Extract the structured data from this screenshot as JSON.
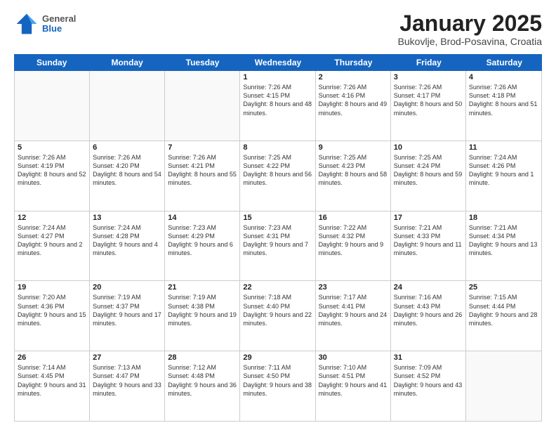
{
  "logo": {
    "general": "General",
    "blue": "Blue"
  },
  "title": "January 2025",
  "subtitle": "Bukovlje, Brod-Posavina, Croatia",
  "days": [
    "Sunday",
    "Monday",
    "Tuesday",
    "Wednesday",
    "Thursday",
    "Friday",
    "Saturday"
  ],
  "weeks": [
    [
      {
        "day": "",
        "info": ""
      },
      {
        "day": "",
        "info": ""
      },
      {
        "day": "",
        "info": ""
      },
      {
        "day": "1",
        "info": "Sunrise: 7:26 AM\nSunset: 4:15 PM\nDaylight: 8 hours\nand 48 minutes."
      },
      {
        "day": "2",
        "info": "Sunrise: 7:26 AM\nSunset: 4:16 PM\nDaylight: 8 hours\nand 49 minutes."
      },
      {
        "day": "3",
        "info": "Sunrise: 7:26 AM\nSunset: 4:17 PM\nDaylight: 8 hours\nand 50 minutes."
      },
      {
        "day": "4",
        "info": "Sunrise: 7:26 AM\nSunset: 4:18 PM\nDaylight: 8 hours\nand 51 minutes."
      }
    ],
    [
      {
        "day": "5",
        "info": "Sunrise: 7:26 AM\nSunset: 4:19 PM\nDaylight: 8 hours\nand 52 minutes."
      },
      {
        "day": "6",
        "info": "Sunrise: 7:26 AM\nSunset: 4:20 PM\nDaylight: 8 hours\nand 54 minutes."
      },
      {
        "day": "7",
        "info": "Sunrise: 7:26 AM\nSunset: 4:21 PM\nDaylight: 8 hours\nand 55 minutes."
      },
      {
        "day": "8",
        "info": "Sunrise: 7:25 AM\nSunset: 4:22 PM\nDaylight: 8 hours\nand 56 minutes."
      },
      {
        "day": "9",
        "info": "Sunrise: 7:25 AM\nSunset: 4:23 PM\nDaylight: 8 hours\nand 58 minutes."
      },
      {
        "day": "10",
        "info": "Sunrise: 7:25 AM\nSunset: 4:24 PM\nDaylight: 8 hours\nand 59 minutes."
      },
      {
        "day": "11",
        "info": "Sunrise: 7:24 AM\nSunset: 4:26 PM\nDaylight: 9 hours\nand 1 minute."
      }
    ],
    [
      {
        "day": "12",
        "info": "Sunrise: 7:24 AM\nSunset: 4:27 PM\nDaylight: 9 hours\nand 2 minutes."
      },
      {
        "day": "13",
        "info": "Sunrise: 7:24 AM\nSunset: 4:28 PM\nDaylight: 9 hours\nand 4 minutes."
      },
      {
        "day": "14",
        "info": "Sunrise: 7:23 AM\nSunset: 4:29 PM\nDaylight: 9 hours\nand 6 minutes."
      },
      {
        "day": "15",
        "info": "Sunrise: 7:23 AM\nSunset: 4:31 PM\nDaylight: 9 hours\nand 7 minutes."
      },
      {
        "day": "16",
        "info": "Sunrise: 7:22 AM\nSunset: 4:32 PM\nDaylight: 9 hours\nand 9 minutes."
      },
      {
        "day": "17",
        "info": "Sunrise: 7:21 AM\nSunset: 4:33 PM\nDaylight: 9 hours\nand 11 minutes."
      },
      {
        "day": "18",
        "info": "Sunrise: 7:21 AM\nSunset: 4:34 PM\nDaylight: 9 hours\nand 13 minutes."
      }
    ],
    [
      {
        "day": "19",
        "info": "Sunrise: 7:20 AM\nSunset: 4:36 PM\nDaylight: 9 hours\nand 15 minutes."
      },
      {
        "day": "20",
        "info": "Sunrise: 7:19 AM\nSunset: 4:37 PM\nDaylight: 9 hours\nand 17 minutes."
      },
      {
        "day": "21",
        "info": "Sunrise: 7:19 AM\nSunset: 4:38 PM\nDaylight: 9 hours\nand 19 minutes."
      },
      {
        "day": "22",
        "info": "Sunrise: 7:18 AM\nSunset: 4:40 PM\nDaylight: 9 hours\nand 22 minutes."
      },
      {
        "day": "23",
        "info": "Sunrise: 7:17 AM\nSunset: 4:41 PM\nDaylight: 9 hours\nand 24 minutes."
      },
      {
        "day": "24",
        "info": "Sunrise: 7:16 AM\nSunset: 4:43 PM\nDaylight: 9 hours\nand 26 minutes."
      },
      {
        "day": "25",
        "info": "Sunrise: 7:15 AM\nSunset: 4:44 PM\nDaylight: 9 hours\nand 28 minutes."
      }
    ],
    [
      {
        "day": "26",
        "info": "Sunrise: 7:14 AM\nSunset: 4:45 PM\nDaylight: 9 hours\nand 31 minutes."
      },
      {
        "day": "27",
        "info": "Sunrise: 7:13 AM\nSunset: 4:47 PM\nDaylight: 9 hours\nand 33 minutes."
      },
      {
        "day": "28",
        "info": "Sunrise: 7:12 AM\nSunset: 4:48 PM\nDaylight: 9 hours\nand 36 minutes."
      },
      {
        "day": "29",
        "info": "Sunrise: 7:11 AM\nSunset: 4:50 PM\nDaylight: 9 hours\nand 38 minutes."
      },
      {
        "day": "30",
        "info": "Sunrise: 7:10 AM\nSunset: 4:51 PM\nDaylight: 9 hours\nand 41 minutes."
      },
      {
        "day": "31",
        "info": "Sunrise: 7:09 AM\nSunset: 4:52 PM\nDaylight: 9 hours\nand 43 minutes."
      },
      {
        "day": "",
        "info": ""
      }
    ]
  ]
}
